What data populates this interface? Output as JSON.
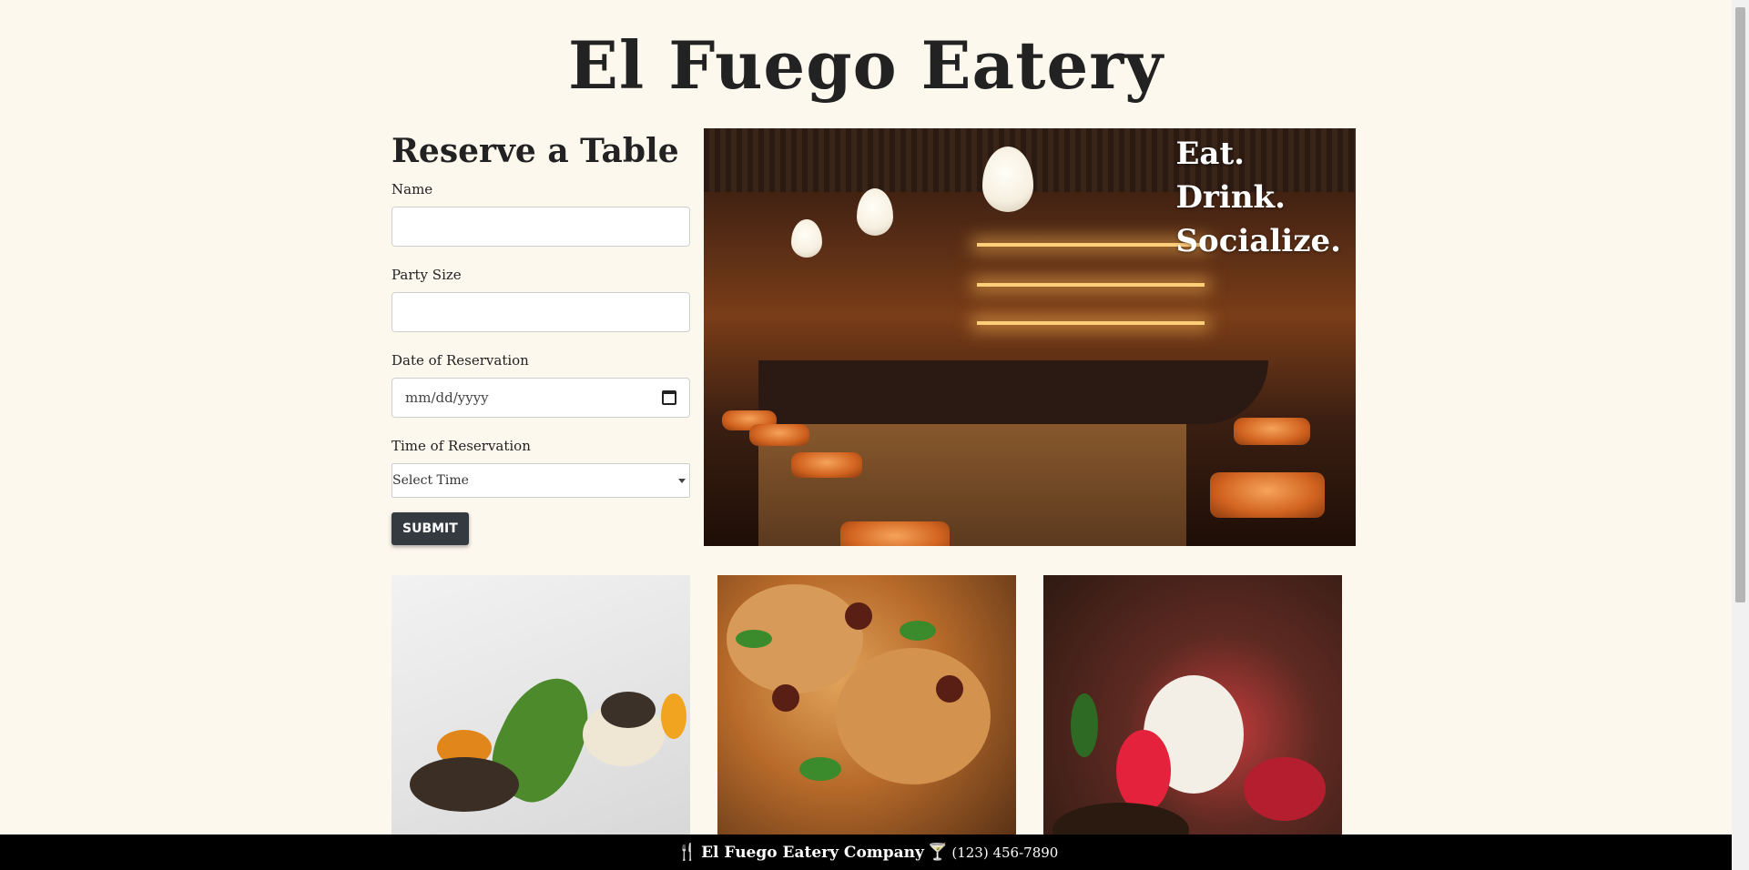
{
  "site": {
    "title": "El Fuego Eatery"
  },
  "reservation_form": {
    "heading": "Reserve a Table",
    "name_label": "Name",
    "name_value": "",
    "party_size_label": "Party Size",
    "party_size_value": "",
    "date_label": "Date of Reservation",
    "date_placeholder": "mm/dd/yyyy",
    "time_label": "Time of Reservation",
    "time_selected": "Select Time",
    "submit_label": "SUBMIT"
  },
  "hero": {
    "tagline": [
      "Eat.",
      "Drink.",
      "Socialize."
    ]
  },
  "gallery": {
    "tiles": [
      "appetizer-dish-photo",
      "chicken-dish-photo",
      "dessert-dish-photo"
    ]
  },
  "footer": {
    "company": "El Fuego Eatery Company",
    "phone": "(123) 456-7890",
    "icons": [
      "utensils-icon",
      "cocktail-icon"
    ]
  },
  "colors": {
    "background": "#fdf8ee",
    "button": "#343a40",
    "footer": "#000000"
  }
}
